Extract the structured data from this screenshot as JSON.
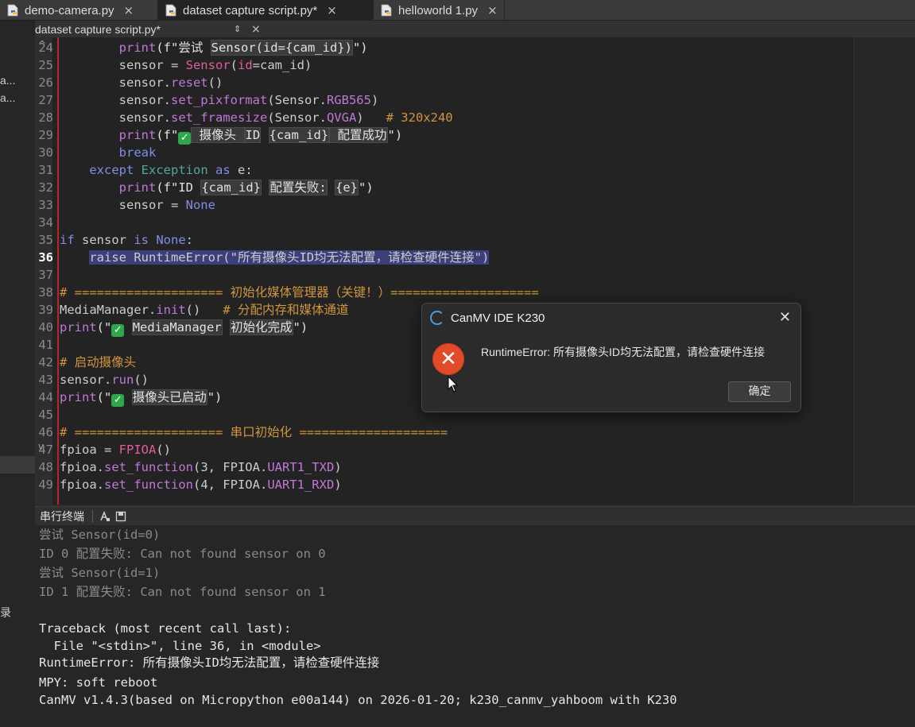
{
  "tabs": [
    {
      "label": "demo-camera.py",
      "active": false
    },
    {
      "label": "dataset capture script.py*",
      "active": true
    },
    {
      "label": "helloworld 1.py",
      "active": false
    }
  ],
  "tab_close_glyph": "×",
  "left_strip": {
    "fragments": [
      "a...",
      "a...",
      "录"
    ]
  },
  "doc_header": {
    "close": "×",
    "filename": "dataset capture script.py*",
    "arrows": "⇕",
    "close2": "×"
  },
  "editor": {
    "current_line": "36",
    "fold_markers": [
      "^",
      "v"
    ]
  },
  "code_lines": [
    {
      "n": "24",
      "parts": [
        [
          "        ",
          ""
        ],
        [
          "print",
          "fn"
        ],
        [
          "(f\"尝试 ",
          "str"
        ],
        [
          "Sensor(id={cam_id})",
          "hlstr"
        ],
        [
          "\")",
          "str"
        ]
      ]
    },
    {
      "n": "25",
      "parts": [
        [
          "        sensor = ",
          ""
        ],
        [
          "Sensor",
          "cls"
        ],
        [
          "(",
          ""
        ],
        [
          "id",
          "cls"
        ],
        [
          "=cam_id)",
          ""
        ]
      ]
    },
    {
      "n": "26",
      "parts": [
        [
          "        sensor.",
          ""
        ],
        [
          "reset",
          "fn"
        ],
        [
          "()",
          ""
        ]
      ]
    },
    {
      "n": "27",
      "parts": [
        [
          "        sensor.",
          ""
        ],
        [
          "set_pixformat",
          "fn"
        ],
        [
          "(Sensor.",
          ""
        ],
        [
          "RGB565",
          "cnst"
        ],
        [
          ")",
          ""
        ]
      ]
    },
    {
      "n": "28",
      "parts": [
        [
          "        sensor.",
          ""
        ],
        [
          "set_framesize",
          "fn"
        ],
        [
          "(Sensor.",
          ""
        ],
        [
          "QVGA",
          "cnst"
        ],
        [
          ")   ",
          ""
        ],
        [
          "# 320x240",
          "cmt"
        ]
      ]
    },
    {
      "n": "29",
      "parts": [
        [
          "        ",
          ""
        ],
        [
          "print",
          "fn"
        ],
        [
          "(f\"",
          "str"
        ],
        [
          "✓",
          "check"
        ],
        [
          " 摄像头 ",
          "hlstr"
        ],
        [
          "ID",
          "hlstr"
        ],
        [
          " ",
          "str"
        ],
        [
          "{cam_id}",
          "hlstr"
        ],
        [
          " 配置成功",
          "hlstr"
        ],
        [
          "\")",
          "str"
        ]
      ]
    },
    {
      "n": "30",
      "parts": [
        [
          "        ",
          ""
        ],
        [
          "break",
          "kw"
        ]
      ]
    },
    {
      "n": "31",
      "parts": [
        [
          "    ",
          ""
        ],
        [
          "except",
          "kw"
        ],
        [
          " ",
          ""
        ],
        [
          "Exception",
          "exc"
        ],
        [
          " ",
          ""
        ],
        [
          "as",
          "kw"
        ],
        [
          " e:",
          ""
        ]
      ]
    },
    {
      "n": "32",
      "parts": [
        [
          "        ",
          ""
        ],
        [
          "print",
          "fn"
        ],
        [
          "(f\"ID ",
          "str"
        ],
        [
          "{cam_id}",
          "hlstr"
        ],
        [
          " ",
          "str"
        ],
        [
          "配置失败:",
          "hlstr"
        ],
        [
          " ",
          "str"
        ],
        [
          "{e}",
          "hlstr"
        ],
        [
          "\")",
          "str"
        ]
      ]
    },
    {
      "n": "33",
      "parts": [
        [
          "        sensor = ",
          ""
        ],
        [
          "None",
          "none"
        ]
      ]
    },
    {
      "n": "34",
      "parts": []
    },
    {
      "n": "35",
      "parts": [
        [
          "if",
          "kw"
        ],
        [
          " sensor ",
          ""
        ],
        [
          "is",
          "kw"
        ],
        [
          " ",
          ""
        ],
        [
          "None",
          "none"
        ],
        [
          ":",
          ""
        ]
      ]
    },
    {
      "n": "36",
      "parts": [
        [
          "    ",
          ""
        ],
        [
          "raise RuntimeError(\"所有摄像头ID均无法配置，请检查硬件连接\")",
          "sel"
        ]
      ]
    },
    {
      "n": "37",
      "parts": []
    },
    {
      "n": "38",
      "parts": [
        [
          "# ==================== 初始化媒体管理器（关键！）====================",
          "cmt"
        ]
      ]
    },
    {
      "n": "39",
      "parts": [
        [
          "MediaManager.",
          ""
        ],
        [
          "init",
          "fn"
        ],
        [
          "()   ",
          ""
        ],
        [
          "# 分配内存和媒体通道",
          "cmt"
        ]
      ]
    },
    {
      "n": "40",
      "parts": [
        [
          "print",
          "fn"
        ],
        [
          "(\"",
          "str"
        ],
        [
          "✓",
          "check"
        ],
        [
          " ",
          "str"
        ],
        [
          "MediaManager",
          "hlstr"
        ],
        [
          " ",
          "str"
        ],
        [
          "初始化完成",
          "hlstr"
        ],
        [
          "\")",
          "str"
        ]
      ]
    },
    {
      "n": "41",
      "parts": []
    },
    {
      "n": "42",
      "parts": [
        [
          "# 启动摄像头",
          "cmt"
        ]
      ]
    },
    {
      "n": "43",
      "parts": [
        [
          "sensor.",
          ""
        ],
        [
          "run",
          "fn"
        ],
        [
          "()",
          ""
        ]
      ]
    },
    {
      "n": "44",
      "parts": [
        [
          "print",
          "fn"
        ],
        [
          "(\"",
          "str"
        ],
        [
          "✓",
          "check"
        ],
        [
          " ",
          "str"
        ],
        [
          "摄像头已启动",
          "hlstr"
        ],
        [
          "\")",
          "str"
        ]
      ]
    },
    {
      "n": "45",
      "parts": []
    },
    {
      "n": "46",
      "parts": [
        [
          "# ==================== 串口初始化 ====================",
          "cmt"
        ]
      ]
    },
    {
      "n": "47",
      "parts": [
        [
          "fpioa = ",
          ""
        ],
        [
          "FPIOA",
          "cls"
        ],
        [
          "()",
          ""
        ]
      ]
    },
    {
      "n": "48",
      "parts": [
        [
          "fpioa.",
          ""
        ],
        [
          "set_function",
          "fn"
        ],
        [
          "(3, FPIOA.",
          ""
        ],
        [
          "UART1_TXD",
          "cnst"
        ],
        [
          ")",
          ""
        ]
      ]
    },
    {
      "n": "49",
      "parts": [
        [
          "fpioa.",
          ""
        ],
        [
          "set_function",
          "fn"
        ],
        [
          "(4, FPIOA.",
          ""
        ],
        [
          "UART1_RXD",
          "cnst"
        ],
        [
          ")",
          ""
        ]
      ]
    }
  ],
  "terminal": {
    "title": "串行终端",
    "icons": [
      "clear-icon",
      "save-icon"
    ],
    "lines": [
      {
        "text": "尝试 Sensor(id=0)",
        "style": "dim"
      },
      {
        "text": "ID 0 配置失败: Can not found sensor on 0",
        "style": "dim"
      },
      {
        "text": "尝试 Sensor(id=1)",
        "style": "dim"
      },
      {
        "text": "ID 1 配置失败: Can not found sensor on 1",
        "style": "dim"
      },
      {
        "text": "",
        "style": "dim"
      },
      {
        "text": "Traceback (most recent call last):",
        "style": "bright"
      },
      {
        "text": "  File \"<stdin>\", line 36, in <module>",
        "style": "bright"
      },
      {
        "text": "RuntimeError: 所有摄像头ID均无法配置，请检查硬件连接",
        "style": "bright"
      },
      {
        "text": "MPY: soft reboot",
        "style": "bright"
      },
      {
        "text": "CanMV v1.4.3(based on Micropython e00a144) on 2026-01-20; k230_canmv_yahboom with K230",
        "style": "bright"
      }
    ]
  },
  "dialog": {
    "title": "CanMV IDE K230",
    "close": "✕",
    "icon_glyph": "✕",
    "message": "RuntimeError: 所有摄像头ID均无法配置，请检查硬件连接",
    "ok_label": "确定"
  },
  "colors": {
    "error_red": "#e24b28",
    "selection": "#3b3f7a",
    "comment": "#d0953c",
    "keyword": "#7f8ee6",
    "function": "#c078d8",
    "check_green": "#2fa64c"
  }
}
